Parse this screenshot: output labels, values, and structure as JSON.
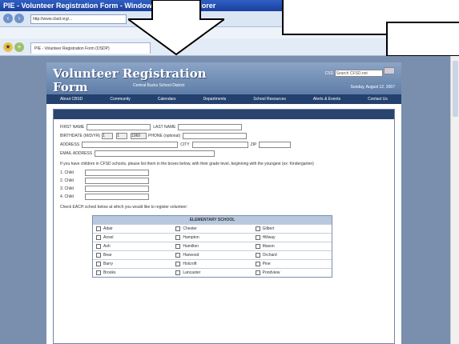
{
  "browser": {
    "title": "PIE - Volunteer Registration Form - Windows Internet Explorer",
    "url": "http://www.cbsd.org/...",
    "tab_label": "PIE - Volunteer Registration Form (OSDP)"
  },
  "site": {
    "title_line1": "Volunteer Registration",
    "title_line2": "Form",
    "subtitle": "Central Bucks School District",
    "search_label": "CSD",
    "search_placeholder": "Search CFSD.net",
    "date": "Sunday, August 12, 2007"
  },
  "menu": [
    "About CBSD",
    "Community",
    "Calendars",
    "Departments",
    "School Resources",
    "Alerts & Events",
    "Contact Us"
  ],
  "form": {
    "first_name_label": "FIRST NAME",
    "last_name_label": "LAST NAME",
    "dob_label": "BIRTHDATE (M/D/YR)",
    "dob_m": "1",
    "dob_d": "1",
    "dob_y": "1960",
    "phone_label": "PHONE (optional)",
    "address_label": "ADDRESS",
    "city_label": "CITY",
    "zip_label": "ZIP",
    "email_label": "EMAIL ADDRESS",
    "children_prompt": "If you have children in CFSD schools, please list them in the boxes below, with their grade level, beginning with the youngest (ex: Kindergarten)",
    "children": [
      "1. Child",
      "2. Child",
      "3. Child",
      "4. Child"
    ],
    "schools_prompt": "Check EACH school below at which you would like to register volunteer:",
    "schools_header": "ELEMENTARY SCHOOL",
    "schools": [
      "Adair",
      "Chester",
      "Gilbert",
      "Ansel",
      "Hampton",
      "Hillway",
      "Ash",
      "Hamilton",
      "Mason",
      "Bear",
      "Harwood",
      "Orchard",
      "Barry",
      "Holcroft",
      "Pine",
      "Brooks",
      "Lancaster",
      "Pondview"
    ]
  }
}
